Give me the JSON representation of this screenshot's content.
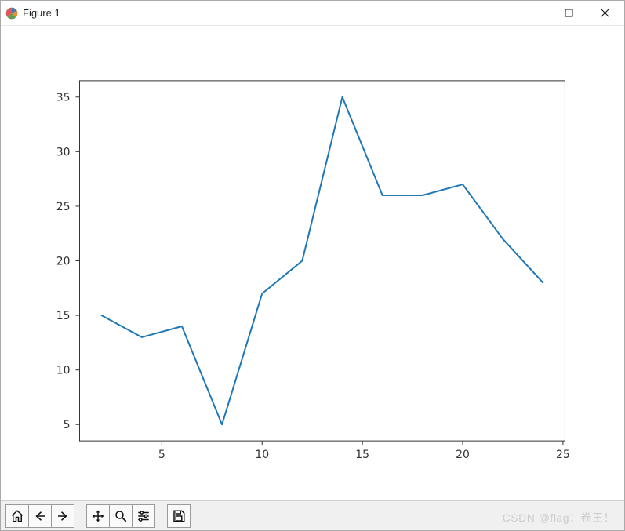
{
  "window": {
    "title": "Figure 1",
    "controls": {
      "minimize": "Minimize",
      "maximize": "Maximize",
      "close": "Close"
    }
  },
  "watermark": "CSDN @flag：卷王！",
  "toolbar": {
    "home": "Home",
    "back": "Back",
    "forward": "Forward",
    "pan": "Pan",
    "zoom": "Zoom",
    "configure": "Configure subplots",
    "save": "Save"
  },
  "chart_data": {
    "type": "line",
    "x": [
      2,
      4,
      6,
      8,
      10,
      12,
      14,
      16,
      18,
      20,
      22,
      24
    ],
    "values": [
      15,
      13,
      14,
      5,
      17,
      20,
      35,
      26,
      26,
      27,
      22,
      18
    ],
    "xticks": [
      5,
      10,
      15,
      20,
      25
    ],
    "yticks": [
      5,
      10,
      15,
      20,
      25,
      30,
      35
    ],
    "xlim": [
      0.9,
      25.1
    ],
    "ylim": [
      3.5,
      36.5
    ],
    "line_color": "#1f77b4"
  }
}
